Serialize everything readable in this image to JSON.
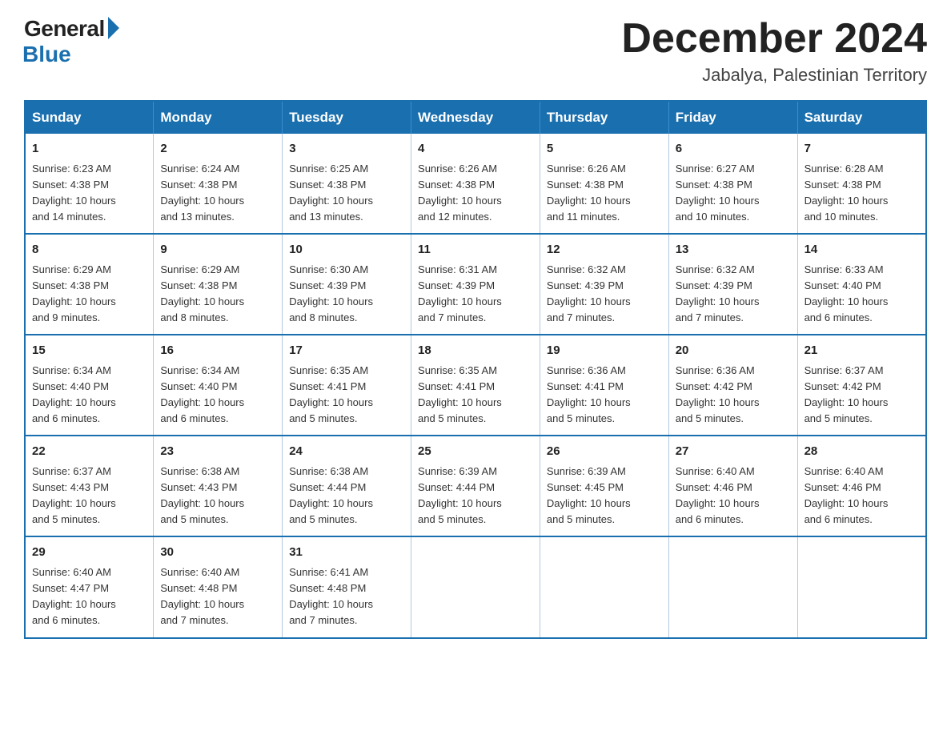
{
  "logo": {
    "general": "General",
    "blue": "Blue",
    "tagline": "Blue"
  },
  "header": {
    "title": "December 2024",
    "subtitle": "Jabalya, Palestinian Territory"
  },
  "days_of_week": [
    "Sunday",
    "Monday",
    "Tuesday",
    "Wednesday",
    "Thursday",
    "Friday",
    "Saturday"
  ],
  "weeks": [
    [
      {
        "day": "1",
        "sunrise": "6:23 AM",
        "sunset": "4:38 PM",
        "daylight": "10 hours and 14 minutes."
      },
      {
        "day": "2",
        "sunrise": "6:24 AM",
        "sunset": "4:38 PM",
        "daylight": "10 hours and 13 minutes."
      },
      {
        "day": "3",
        "sunrise": "6:25 AM",
        "sunset": "4:38 PM",
        "daylight": "10 hours and 13 minutes."
      },
      {
        "day": "4",
        "sunrise": "6:26 AM",
        "sunset": "4:38 PM",
        "daylight": "10 hours and 12 minutes."
      },
      {
        "day": "5",
        "sunrise": "6:26 AM",
        "sunset": "4:38 PM",
        "daylight": "10 hours and 11 minutes."
      },
      {
        "day": "6",
        "sunrise": "6:27 AM",
        "sunset": "4:38 PM",
        "daylight": "10 hours and 10 minutes."
      },
      {
        "day": "7",
        "sunrise": "6:28 AM",
        "sunset": "4:38 PM",
        "daylight": "10 hours and 10 minutes."
      }
    ],
    [
      {
        "day": "8",
        "sunrise": "6:29 AM",
        "sunset": "4:38 PM",
        "daylight": "10 hours and 9 minutes."
      },
      {
        "day": "9",
        "sunrise": "6:29 AM",
        "sunset": "4:38 PM",
        "daylight": "10 hours and 8 minutes."
      },
      {
        "day": "10",
        "sunrise": "6:30 AM",
        "sunset": "4:39 PM",
        "daylight": "10 hours and 8 minutes."
      },
      {
        "day": "11",
        "sunrise": "6:31 AM",
        "sunset": "4:39 PM",
        "daylight": "10 hours and 7 minutes."
      },
      {
        "day": "12",
        "sunrise": "6:32 AM",
        "sunset": "4:39 PM",
        "daylight": "10 hours and 7 minutes."
      },
      {
        "day": "13",
        "sunrise": "6:32 AM",
        "sunset": "4:39 PM",
        "daylight": "10 hours and 7 minutes."
      },
      {
        "day": "14",
        "sunrise": "6:33 AM",
        "sunset": "4:40 PM",
        "daylight": "10 hours and 6 minutes."
      }
    ],
    [
      {
        "day": "15",
        "sunrise": "6:34 AM",
        "sunset": "4:40 PM",
        "daylight": "10 hours and 6 minutes."
      },
      {
        "day": "16",
        "sunrise": "6:34 AM",
        "sunset": "4:40 PM",
        "daylight": "10 hours and 6 minutes."
      },
      {
        "day": "17",
        "sunrise": "6:35 AM",
        "sunset": "4:41 PM",
        "daylight": "10 hours and 5 minutes."
      },
      {
        "day": "18",
        "sunrise": "6:35 AM",
        "sunset": "4:41 PM",
        "daylight": "10 hours and 5 minutes."
      },
      {
        "day": "19",
        "sunrise": "6:36 AM",
        "sunset": "4:41 PM",
        "daylight": "10 hours and 5 minutes."
      },
      {
        "day": "20",
        "sunrise": "6:36 AM",
        "sunset": "4:42 PM",
        "daylight": "10 hours and 5 minutes."
      },
      {
        "day": "21",
        "sunrise": "6:37 AM",
        "sunset": "4:42 PM",
        "daylight": "10 hours and 5 minutes."
      }
    ],
    [
      {
        "day": "22",
        "sunrise": "6:37 AM",
        "sunset": "4:43 PM",
        "daylight": "10 hours and 5 minutes."
      },
      {
        "day": "23",
        "sunrise": "6:38 AM",
        "sunset": "4:43 PM",
        "daylight": "10 hours and 5 minutes."
      },
      {
        "day": "24",
        "sunrise": "6:38 AM",
        "sunset": "4:44 PM",
        "daylight": "10 hours and 5 minutes."
      },
      {
        "day": "25",
        "sunrise": "6:39 AM",
        "sunset": "4:44 PM",
        "daylight": "10 hours and 5 minutes."
      },
      {
        "day": "26",
        "sunrise": "6:39 AM",
        "sunset": "4:45 PM",
        "daylight": "10 hours and 5 minutes."
      },
      {
        "day": "27",
        "sunrise": "6:40 AM",
        "sunset": "4:46 PM",
        "daylight": "10 hours and 6 minutes."
      },
      {
        "day": "28",
        "sunrise": "6:40 AM",
        "sunset": "4:46 PM",
        "daylight": "10 hours and 6 minutes."
      }
    ],
    [
      {
        "day": "29",
        "sunrise": "6:40 AM",
        "sunset": "4:47 PM",
        "daylight": "10 hours and 6 minutes."
      },
      {
        "day": "30",
        "sunrise": "6:40 AM",
        "sunset": "4:48 PM",
        "daylight": "10 hours and 7 minutes."
      },
      {
        "day": "31",
        "sunrise": "6:41 AM",
        "sunset": "4:48 PM",
        "daylight": "10 hours and 7 minutes."
      },
      null,
      null,
      null,
      null
    ]
  ],
  "labels": {
    "sunrise": "Sunrise:",
    "sunset": "Sunset:",
    "daylight": "Daylight:"
  }
}
